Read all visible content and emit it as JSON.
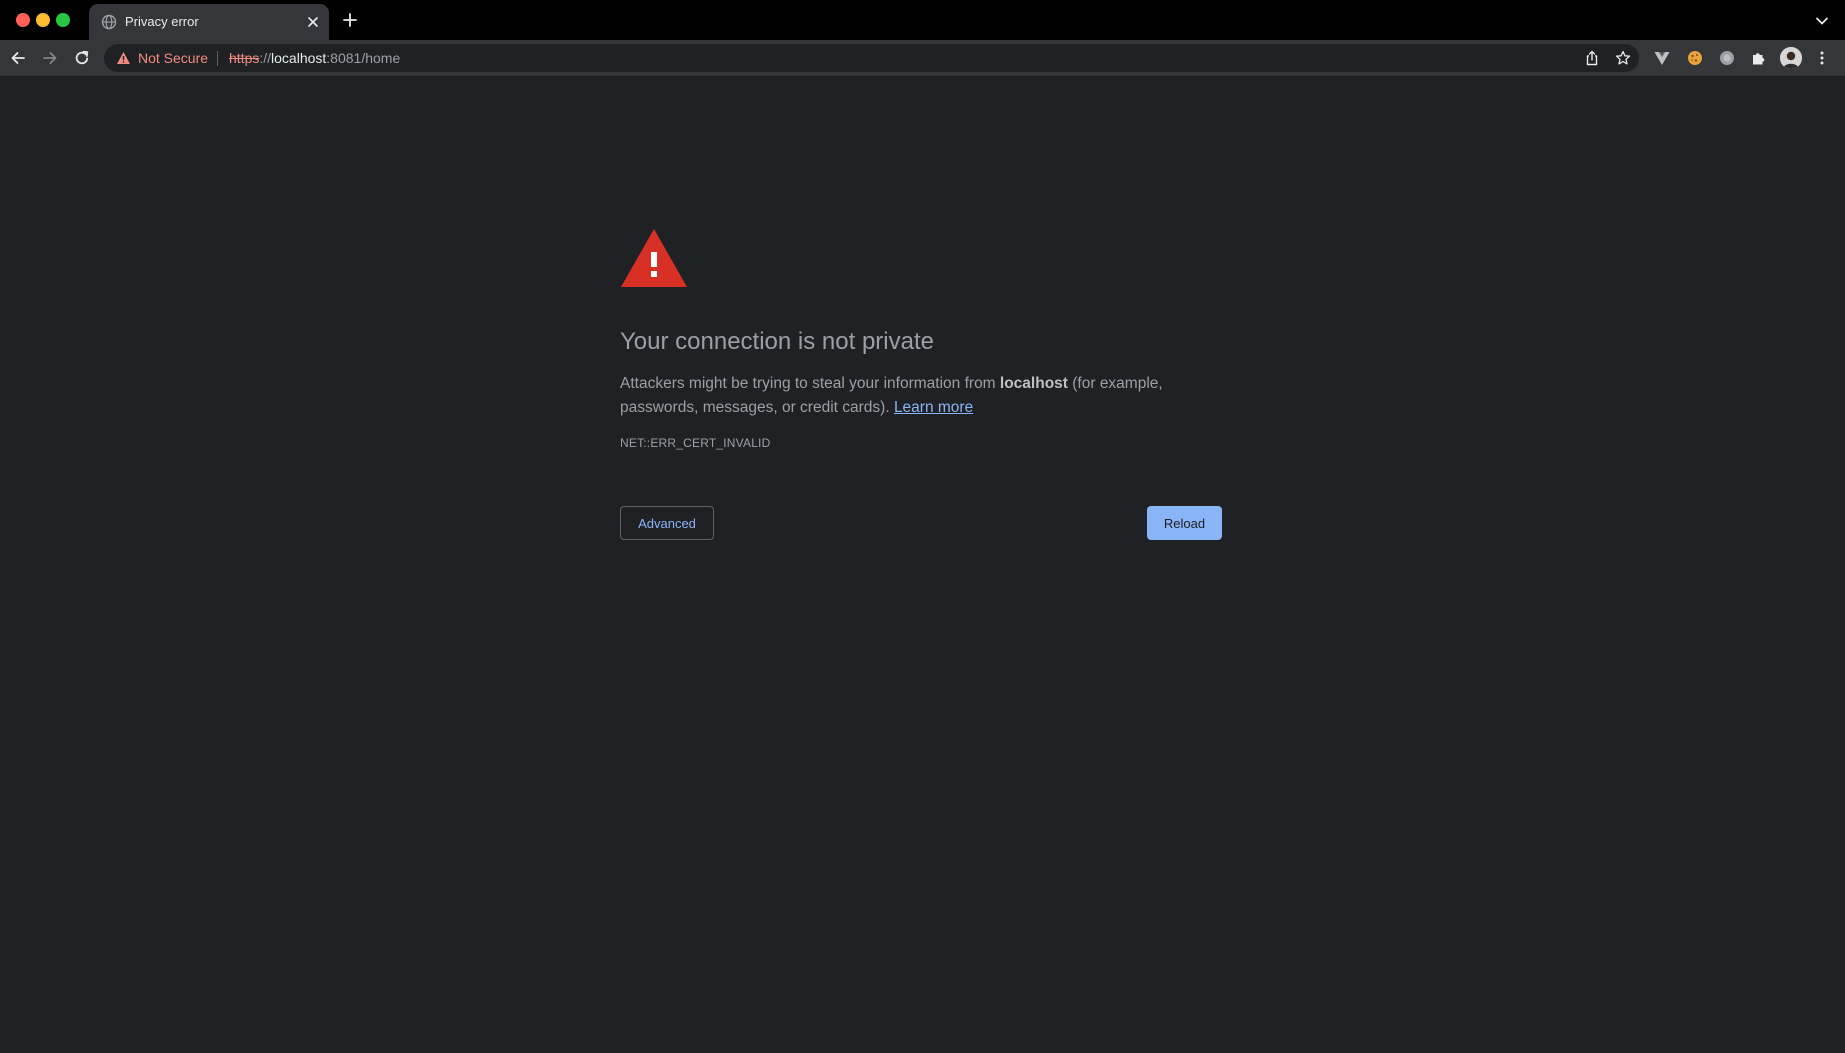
{
  "tab": {
    "title": "Privacy error"
  },
  "omnibox": {
    "security_label": "Not Secure",
    "url_scheme": "https",
    "url_separator": "://",
    "url_host": "localhost",
    "url_rest": ":8081/home"
  },
  "interstitial": {
    "heading": "Your connection is not private",
    "explanation_before": "Attackers might be trying to steal your information from ",
    "explanation_host": "localhost",
    "explanation_after": " (for example, passwords, messages, or credit cards). ",
    "learn_more": "Learn more",
    "error_code": "NET::ERR_CERT_INVALID",
    "advanced_label": "Advanced",
    "reload_label": "Reload"
  },
  "colors": {
    "background": "#202124",
    "warning_red": "#d93025",
    "link_blue": "#8ab4f8",
    "not_secure_red": "#f28b82"
  },
  "icons": {
    "tab_favicon": "globe-icon",
    "tab_close": "close-icon",
    "new_tab": "plus-icon",
    "tab_search": "chevron-down-icon",
    "back": "arrow-left-icon",
    "forward": "arrow-right-icon",
    "reload": "reload-icon",
    "security": "warning-triangle-icon",
    "share": "share-icon",
    "bookmark": "star-icon",
    "extensions": [
      "vue-devtools-icon",
      "cookie-icon",
      "gray-circle-extension-icon",
      "puzzle-icon"
    ],
    "profile": "avatar",
    "menu": "kebab-menu-icon"
  }
}
